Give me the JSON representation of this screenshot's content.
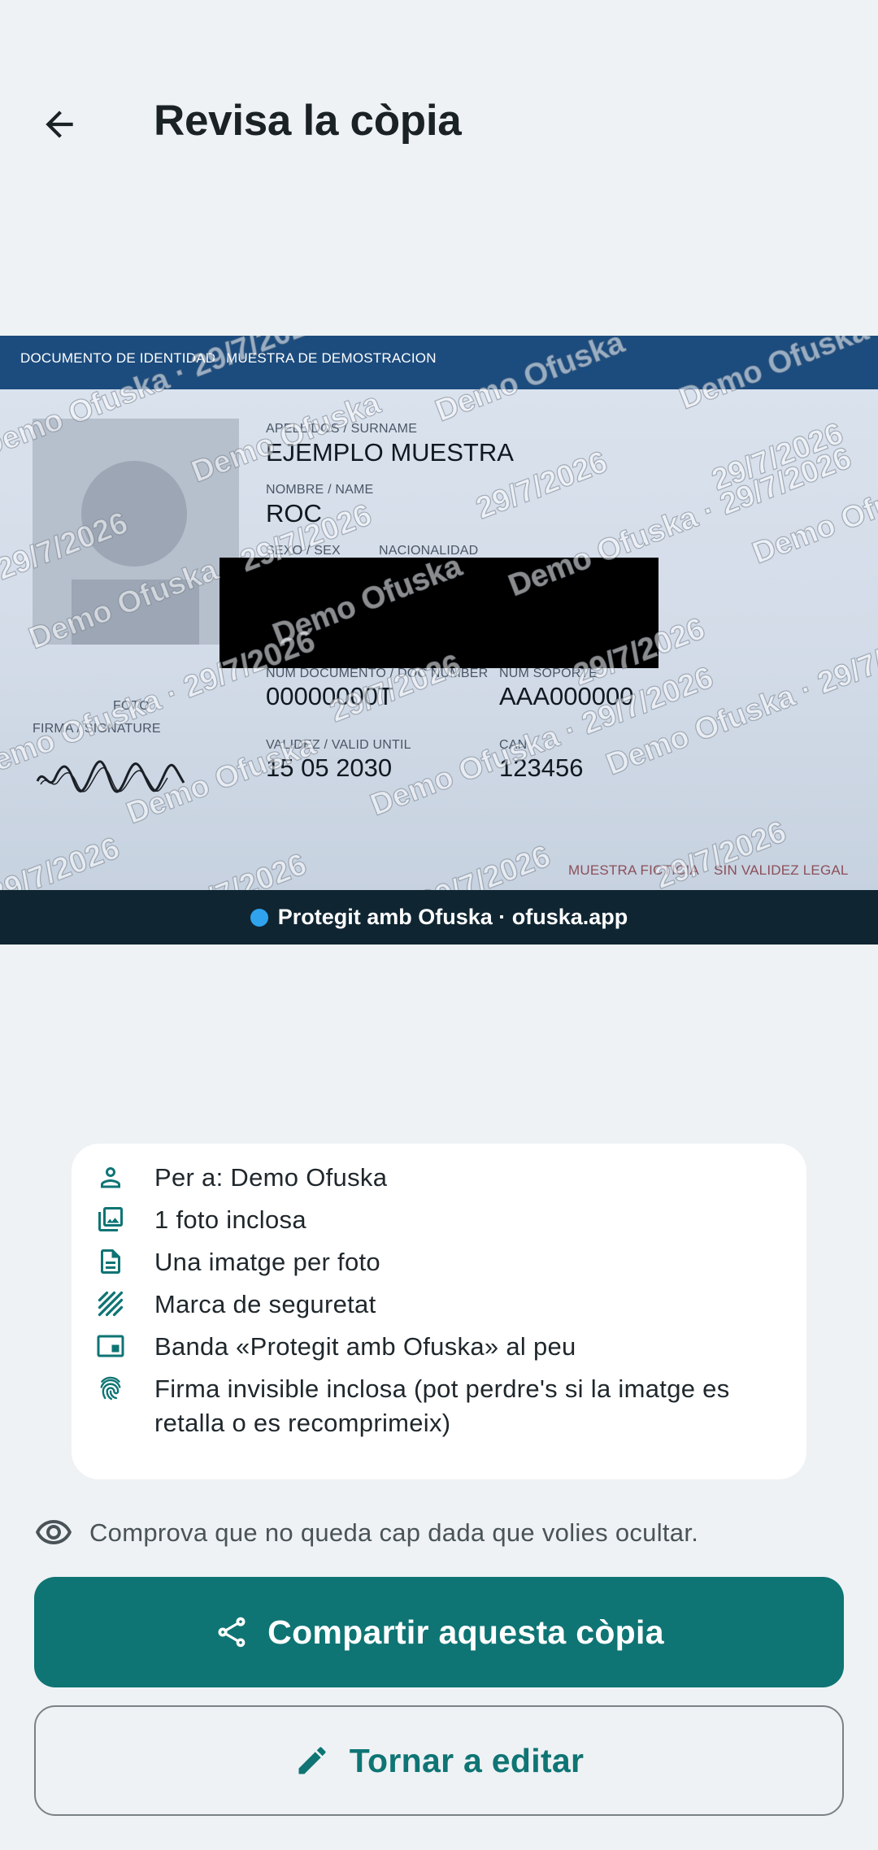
{
  "appbar": {
    "title": "Revisa la còpia",
    "back_icon": "arrow-back-icon"
  },
  "card": {
    "header_left": "DOCUMENTO DE IDENTIDAD",
    "header_right": "MUESTRA DE DEMOSTRACION",
    "surname_label": "APELLIDOS / SURNAME",
    "surname": "EJEMPLO MUESTRA",
    "name_label": "NOMBRE / NAME",
    "name": "ROC",
    "sex_label": "SEXO / SEX",
    "nationality_label": "NACIONALIDAD",
    "docnum_label": "NUM DOCUMENTO / DOC NUMBER",
    "docnum": "00000000T",
    "support_label": "NUM SOPORTE",
    "support": "AAA000000",
    "photo_label": "FOTO",
    "signature_label": "FIRMA / SIGNATURE",
    "validity_label": "VALIDEZ / VALID UNTIL",
    "validity": "15 05 2030",
    "can_label": "CAN",
    "can": "123456",
    "footer_left": "MUESTRA FICTICIA",
    "footer_right": "SIN VALIDEZ LEGAL",
    "watermark_name": "Demo Ofuska",
    "watermark_date": "29/7/2026",
    "watermark_combined": "Demo Ofuska · 29/7/2026"
  },
  "banner": {
    "text": "Protegit amb Ofuska · ofuska.app",
    "dot_color": "#2fa3ee"
  },
  "info": {
    "items": [
      {
        "icon": "person-icon",
        "text": "Per a: Demo Ofuska"
      },
      {
        "icon": "photo-library-icon",
        "text": "1 foto inclosa"
      },
      {
        "icon": "document-icon",
        "text": "Una imatge per foto"
      },
      {
        "icon": "hatch-pattern-icon",
        "text": "Marca de seguretat"
      },
      {
        "icon": "footer-band-icon",
        "text": "Banda «Protegit amb Ofuska» al peu"
      },
      {
        "icon": "fingerprint-icon",
        "text": "Firma invisible inclosa (pot perdre's si la imatge es retalla o es recomprimeix)"
      }
    ]
  },
  "check_note": {
    "icon": "eye-icon",
    "text": "Comprova que no queda cap dada que volies ocultar."
  },
  "actions": {
    "share_label": "Compartir aquesta còpia",
    "share_icon": "share-icon",
    "edit_label": "Tornar a editar",
    "edit_icon": "pencil-icon"
  },
  "colors": {
    "accent": "#0f7474",
    "card_header": "#1c4c7e",
    "banner_bg": "#0f2532",
    "background": "#eef2f4"
  }
}
